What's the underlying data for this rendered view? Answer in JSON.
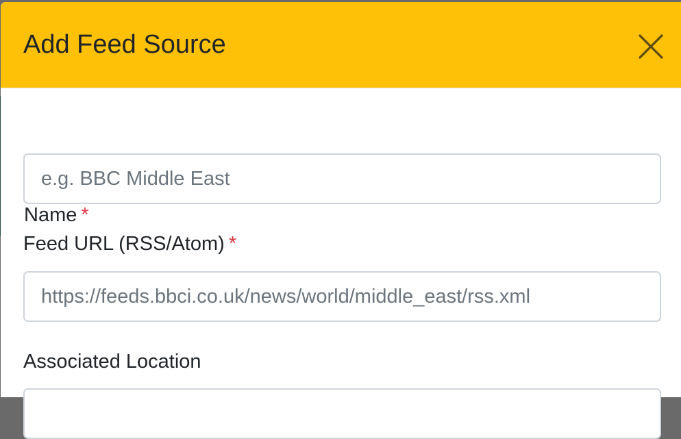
{
  "modal": {
    "title": "Add Feed Source",
    "close_icon": "close-icon"
  },
  "form": {
    "name": {
      "label": "Name",
      "required_mark": "*",
      "placeholder": "e.g. BBC Middle East",
      "value": ""
    },
    "feed_url": {
      "label": "Feed URL (RSS/Atom)",
      "required_mark": "*",
      "placeholder": "https://feeds.bbci.co.uk/news/world/middle_east/rss.xml",
      "value": ""
    },
    "associated_location": {
      "label": "Associated Location"
    }
  },
  "colors": {
    "header_background": "#ffc107",
    "required_mark": "#dc3545",
    "input_border": "#ced4da"
  }
}
